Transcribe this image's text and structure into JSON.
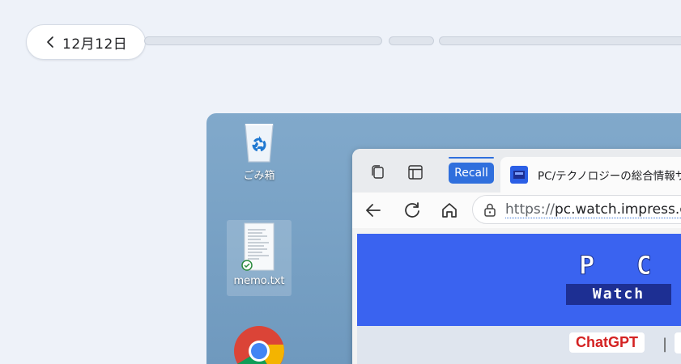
{
  "timeline": {
    "date_label": "12月12日",
    "back_icon": "chevron-left-icon"
  },
  "desktop": {
    "icons": [
      {
        "label": "ごみ箱",
        "icon": "recycle-bin-icon"
      },
      {
        "label": "memo.txt",
        "icon": "text-file-icon"
      },
      {
        "label": "",
        "icon": "chrome-icon"
      }
    ]
  },
  "browser": {
    "tabbar": {
      "workspaces_icon": "workspaces-icon",
      "tab_actions_icon": "vertical-tabs-icon",
      "recall_tab_label": "Recall",
      "page_tab_title": "PC/テクノロジーの総合情報サ"
    },
    "nav": {
      "back_icon": "back-arrow-icon",
      "refresh_icon": "refresh-icon",
      "home_icon": "home-icon",
      "url_protocol": "https://",
      "url_rest": "pc.watch.impress.co"
    },
    "page": {
      "logo_top": "P C",
      "logo_bottom": "Watch",
      "nav_chip": "ChatGPT",
      "separator": "|"
    }
  },
  "colors": {
    "background": "#eef2f9",
    "accent": "#2f6fdd",
    "pcw_blue": "#3a63f0",
    "chatgpt_red": "#d42222"
  }
}
